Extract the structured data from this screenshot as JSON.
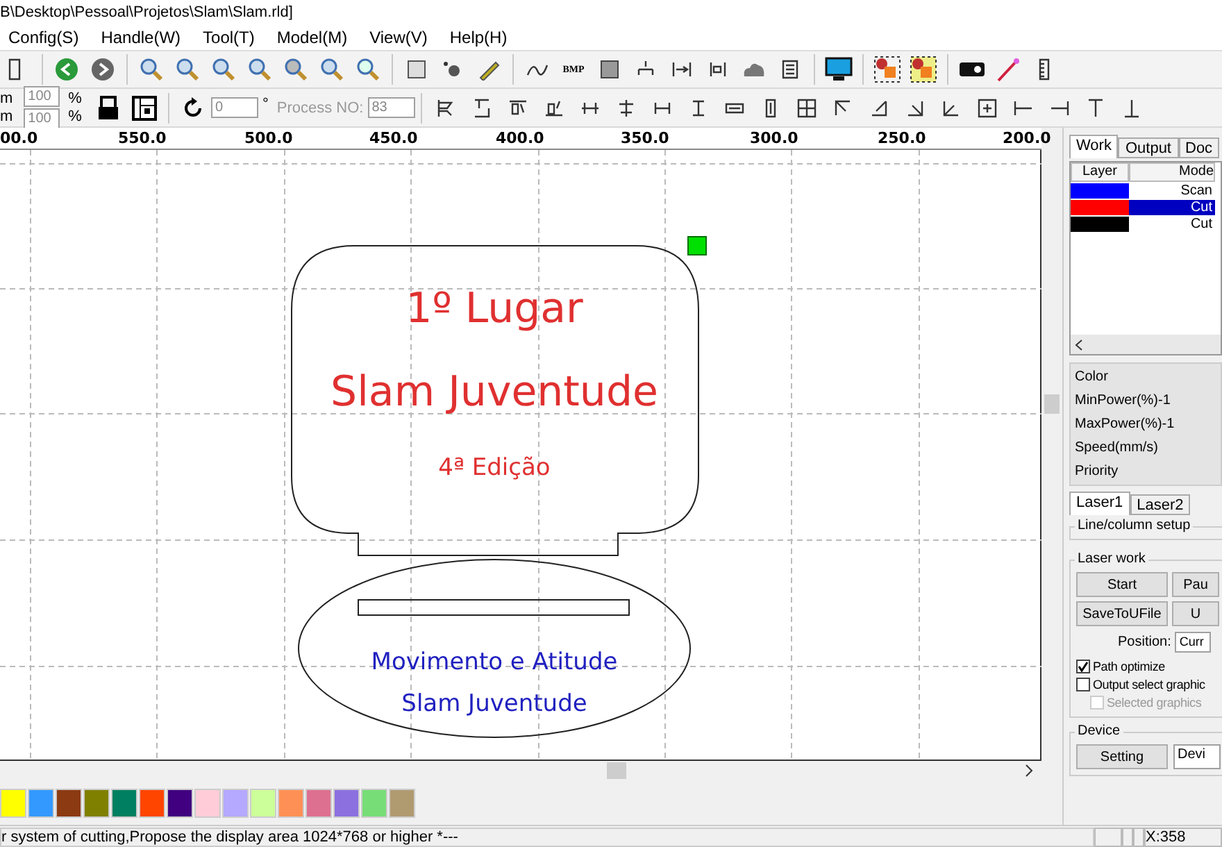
{
  "window": {
    "title": "B\\Desktop\\Pessoal\\Projetos\\Slam\\Slam.rld]"
  },
  "menu": [
    "Config(S)",
    "Handle(W)",
    "Tool(T)",
    "Model(M)",
    "View(V)",
    "Help(H)"
  ],
  "toolbar": {
    "bmp_label": "BMP"
  },
  "transform_bar": {
    "unit_labels": [
      "m",
      "m"
    ],
    "scale_values": [
      "100",
      "100"
    ],
    "percent_labels": [
      "%",
      "%"
    ],
    "angle_value": "0",
    "degree_sign": "°",
    "process_label": "Process NO:",
    "process_value": "83"
  },
  "ruler": [
    "00.0",
    "550.0",
    "500.0",
    "450.0",
    "400.0",
    "350.0",
    "300.0",
    "250.0",
    "200.0"
  ],
  "canvas": {
    "texts": [
      {
        "text": "1º Lugar",
        "color": "#e03030"
      },
      {
        "text": "Slam Juventude",
        "color": "#e03030"
      },
      {
        "text": "4ª Edição",
        "color": "#e03030"
      },
      {
        "text": "Movimento e Atitude",
        "color": "#2020c0"
      },
      {
        "text": "Slam Juventude",
        "color": "#2020c0"
      }
    ]
  },
  "panel": {
    "tabs": [
      {
        "label": "Work",
        "selected": true
      },
      {
        "label": "Output",
        "selected": false
      },
      {
        "label": "Doc",
        "selected": false
      }
    ],
    "layer_columns": [
      "Layer",
      "Mode"
    ],
    "layers": [
      {
        "color": "#0000ff",
        "mode": "Scan",
        "selected": false
      },
      {
        "color": "#ff0000",
        "mode": "Cut",
        "selected": true
      },
      {
        "color": "#000000",
        "mode": "Cut",
        "selected": false
      }
    ],
    "properties": [
      "Color",
      "MinPower(%)-1",
      "MaxPower(%)-1",
      "Speed(mm/s)",
      "Priority"
    ],
    "laser_tabs": [
      {
        "label": "Laser1",
        "selected": true
      },
      {
        "label": "Laser2",
        "selected": false
      }
    ],
    "line_setup_label": "Line/column setup",
    "laser_work": {
      "label": "Laser work",
      "buttons": [
        "Start",
        "Pau",
        "SaveToUFile",
        "U"
      ],
      "position_label": "Position:",
      "position_value": "Curr",
      "checkboxes": [
        {
          "label": "Path optimize",
          "checked": true,
          "disabled": false,
          "indented": false
        },
        {
          "label": "Output select graphic",
          "checked": false,
          "disabled": false,
          "indented": false
        },
        {
          "label": "Selected graphics",
          "checked": false,
          "disabled": true,
          "indented": true
        }
      ]
    },
    "device": {
      "label": "Device",
      "button": "Setting",
      "select_value": "Devi"
    }
  },
  "palette": [
    {
      "color": "#ffff00"
    },
    {
      "color": "#3399ff"
    },
    {
      "color": "#8b3a12"
    },
    {
      "color": "#808000"
    },
    {
      "color": "#008060"
    },
    {
      "color": "#ff4500"
    },
    {
      "color": "#400080"
    },
    {
      "color": "#ffccd8"
    },
    {
      "color": "#b4a8ff"
    },
    {
      "color": "#ccff99"
    },
    {
      "color": "#ff9055"
    },
    {
      "color": "#dd7090"
    },
    {
      "color": "#8c70e0"
    },
    {
      "color": "#77dd77"
    },
    {
      "color": "#b09a70"
    }
  ],
  "status_bar": {
    "message": "r system of cutting,Propose the display area 1024*768 or higher *---",
    "coords": "X:358"
  }
}
